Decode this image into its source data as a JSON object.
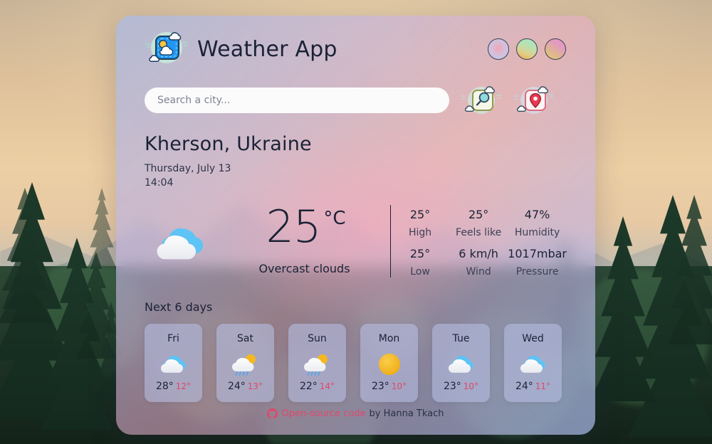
{
  "header": {
    "app_title": "Weather App",
    "logo_icon": "weather-app-logo-icon",
    "unit_buttons": [
      {
        "name": "unit-button-1",
        "color": "#f0a7b6"
      },
      {
        "name": "unit-button-2",
        "color": "#a8e4c4"
      },
      {
        "name": "unit-button-3",
        "color": "#e896c0"
      }
    ]
  },
  "search": {
    "placeholder": "Search a city...",
    "value": "",
    "search_icon": "magnifier-icon",
    "location_icon": "map-pin-icon"
  },
  "location": {
    "city": "Kherson, Ukraine",
    "date": "Thursday, July 13",
    "time": "14:04"
  },
  "current": {
    "icon": "overcast-clouds-icon",
    "temperature": "25",
    "unit": "°C",
    "description": "Overcast clouds",
    "stats": [
      {
        "value": "25°",
        "label": "High"
      },
      {
        "value": "25°",
        "label": "Feels like"
      },
      {
        "value": "47%",
        "label": "Humidity"
      },
      {
        "value": "25°",
        "label": "Low"
      },
      {
        "value": "6 km/h",
        "label": "Wind"
      },
      {
        "value": "1017mbar",
        "label": "Pressure"
      }
    ]
  },
  "forecast": {
    "title": "Next 6 days",
    "days": [
      {
        "day": "Fri",
        "icon": "cloud-icon",
        "max": "28°",
        "min": "12°"
      },
      {
        "day": "Sat",
        "icon": "sun-cloud-rain-icon",
        "max": "24°",
        "min": "13°"
      },
      {
        "day": "Sun",
        "icon": "sun-cloud-rain-icon",
        "max": "22°",
        "min": "14°"
      },
      {
        "day": "Mon",
        "icon": "sun-icon",
        "max": "23°",
        "min": "10°"
      },
      {
        "day": "Tue",
        "icon": "cloud-icon",
        "max": "23°",
        "min": "10°"
      },
      {
        "day": "Wed",
        "icon": "cloud-icon",
        "max": "24°",
        "min": "11°"
      }
    ]
  },
  "footer": {
    "github_icon": "github-icon",
    "link_text": "Open-source code",
    "suffix_text": "by Hanna Tkach",
    "link_color": "#e0476b"
  }
}
